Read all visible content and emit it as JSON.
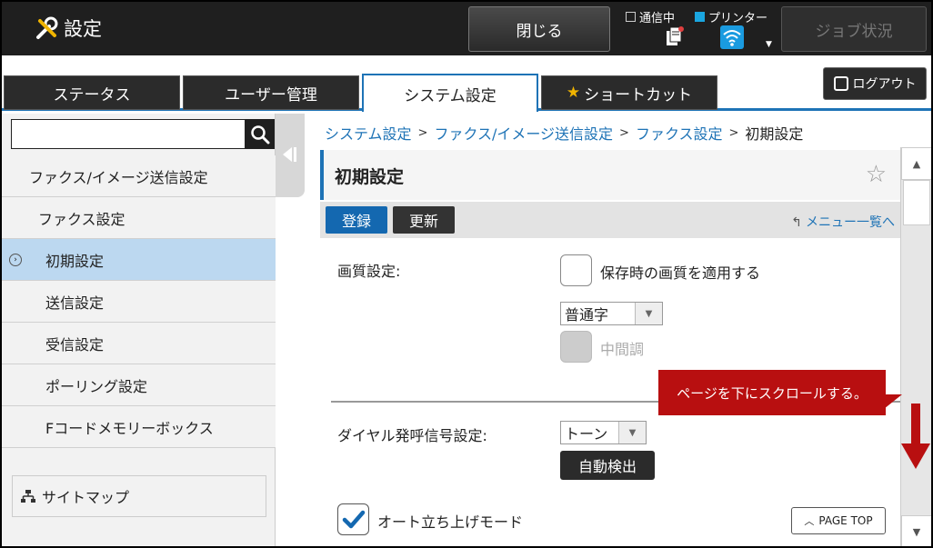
{
  "header": {
    "title": "設定",
    "close_label": "閉じる",
    "status_comm": "通信中",
    "status_printer": "プリンター",
    "job_status_label": "ジョブ状況"
  },
  "tabs": [
    {
      "label": "ステータス"
    },
    {
      "label": "ユーザー管理"
    },
    {
      "label": "システム設定"
    },
    {
      "label": "ショートカット"
    }
  ],
  "logout_label": "ログアウト",
  "sidebar": {
    "search_value": "",
    "items": [
      {
        "label": "ファクス/イメージ送信設定"
      },
      {
        "label": "ファクス設定"
      },
      {
        "label": "初期設定"
      },
      {
        "label": "送信設定"
      },
      {
        "label": "受信設定"
      },
      {
        "label": "ポーリング設定"
      },
      {
        "label": "Fコードメモリーボックス"
      }
    ],
    "sitemap_label": "サイトマップ"
  },
  "breadcrumb": {
    "items": [
      "システム設定",
      "ファクス/イメージ送信設定",
      "ファクス設定",
      "初期設定"
    ],
    "separator": ">"
  },
  "page": {
    "title": "初期設定",
    "register_label": "登録",
    "update_label": "更新",
    "menu_link_label": "メニュー一覧へ"
  },
  "form": {
    "quality_label": "画質設定:",
    "apply_saved_quality_label": "保存時の画質を適用する",
    "quality_select_value": "普通字",
    "halftone_label": "中間調",
    "dial_signal_label": "ダイヤル発呼信号設定:",
    "dial_select_value": "トーン",
    "auto_detect_label": "自動検出",
    "auto_start_label": "オート立ち上げモード",
    "page_top_label": "PAGE TOP"
  },
  "callout": {
    "text": "ページを下にスクロールする。"
  },
  "colors": {
    "accent_blue": "#1e73b6",
    "callout_red": "#b80f10",
    "selected_bg": "#bcd8f0"
  }
}
